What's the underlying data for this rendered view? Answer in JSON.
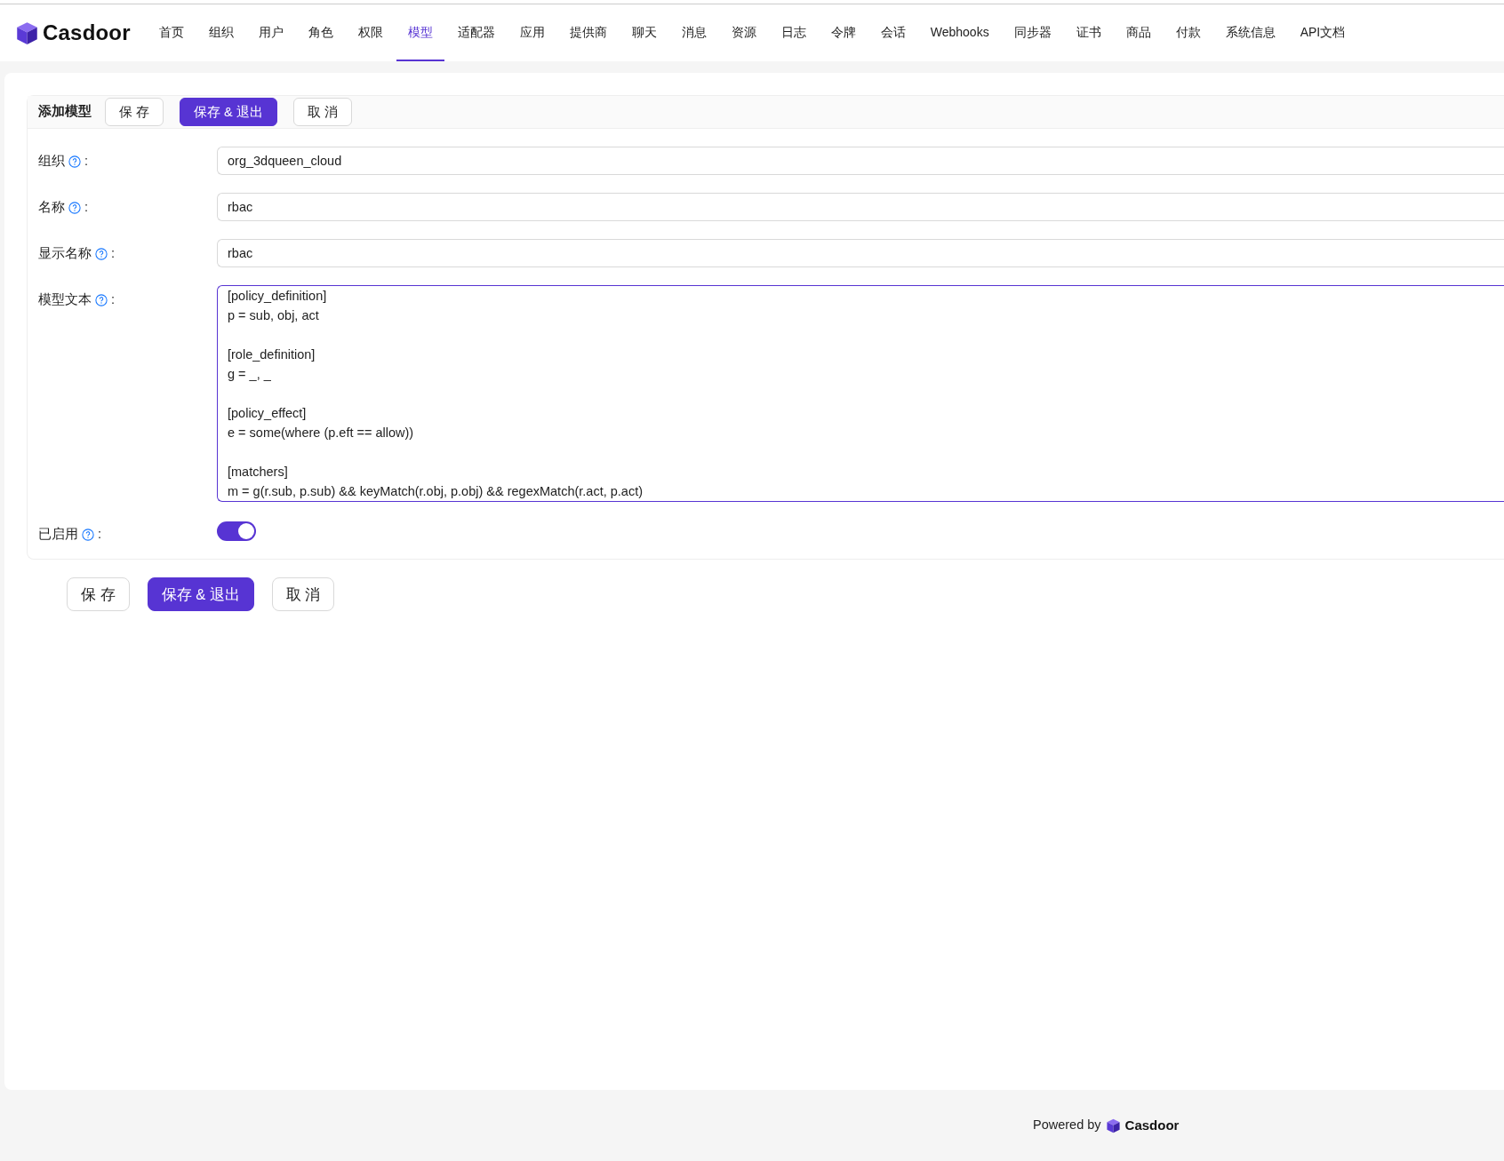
{
  "brand": {
    "name": "Casdoor"
  },
  "nav": [
    {
      "label": "首页",
      "selected": false
    },
    {
      "label": "组织",
      "selected": false
    },
    {
      "label": "用户",
      "selected": false
    },
    {
      "label": "角色",
      "selected": false
    },
    {
      "label": "权限",
      "selected": false
    },
    {
      "label": "模型",
      "selected": true
    },
    {
      "label": "适配器",
      "selected": false
    },
    {
      "label": "应用",
      "selected": false
    },
    {
      "label": "提供商",
      "selected": false
    },
    {
      "label": "聊天",
      "selected": false
    },
    {
      "label": "消息",
      "selected": false
    },
    {
      "label": "资源",
      "selected": false
    },
    {
      "label": "日志",
      "selected": false
    },
    {
      "label": "令牌",
      "selected": false
    },
    {
      "label": "会话",
      "selected": false
    },
    {
      "label": "Webhooks",
      "selected": false
    },
    {
      "label": "同步器",
      "selected": false
    },
    {
      "label": "证书",
      "selected": false
    },
    {
      "label": "商品",
      "selected": false
    },
    {
      "label": "付款",
      "selected": false
    },
    {
      "label": "系统信息",
      "selected": false
    },
    {
      "label": "API文档",
      "selected": false
    }
  ],
  "form": {
    "title": "添加模型",
    "header_buttons": [
      {
        "label": "保 存",
        "kind": "default"
      },
      {
        "label": "保存 & 退出",
        "kind": "primary"
      },
      {
        "label": "取 消",
        "kind": "default"
      }
    ],
    "fields": [
      {
        "kind": "input",
        "label": "组织",
        "colon": ":",
        "value": "org_3dqueen_cloud"
      },
      {
        "kind": "input",
        "label": "名称",
        "colon": ":",
        "value": "rbac"
      },
      {
        "kind": "input",
        "label": "显示名称",
        "colon": ":",
        "value": "rbac"
      },
      {
        "kind": "textarea",
        "label": "模型文本",
        "colon": ":",
        "value": "[policy_definition]\np = sub, obj, act\n\n[role_definition]\ng = _, _\n\n[policy_effect]\ne = some(where (p.eft == allow))\n\n[matchers]\nm = g(r.sub, p.sub) && keyMatch(r.obj, p.obj) && regexMatch(r.act, p.act)"
      },
      {
        "kind": "switch",
        "label": "已启用",
        "colon": ":",
        "on": true
      }
    ],
    "footer_buttons": [
      {
        "label": "保 存",
        "kind": "default"
      },
      {
        "label": "保存 & 退出",
        "kind": "primary"
      },
      {
        "label": "取 消",
        "kind": "default"
      }
    ]
  },
  "footer": {
    "text": "Powered by",
    "brand": "Casdoor"
  }
}
